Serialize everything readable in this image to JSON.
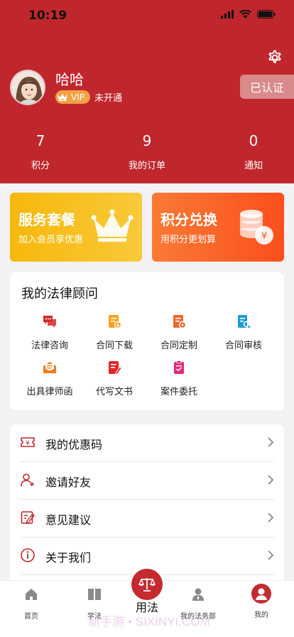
{
  "status_bar": {
    "time": "10:19"
  },
  "profile": {
    "name": "哈哈",
    "vip_badge": "VIP",
    "vip_status": "未开通",
    "verified_label": "已认证"
  },
  "stats": [
    {
      "value": "7",
      "label": "积分"
    },
    {
      "value": "9",
      "label": "我的订单"
    },
    {
      "value": "0",
      "label": "通知"
    }
  ],
  "promos": [
    {
      "title": "服务套餐",
      "subtitle": "加入会员享优惠"
    },
    {
      "title": "积分兑换",
      "subtitle": "用积分更划算"
    }
  ],
  "advisor": {
    "title": "我的法律顾问",
    "services": [
      {
        "label": "法律咨询",
        "icon": "chat-icon"
      },
      {
        "label": "合同下载",
        "icon": "contract-download-icon"
      },
      {
        "label": "合同定制",
        "icon": "contract-custom-icon"
      },
      {
        "label": "合同审核",
        "icon": "contract-review-icon"
      },
      {
        "label": "出具律师函",
        "icon": "lawyer-letter-icon"
      },
      {
        "label": "代写文书",
        "icon": "document-writing-icon"
      },
      {
        "label": "案件委托",
        "icon": "case-entrust-icon"
      }
    ]
  },
  "menu": [
    {
      "label": "我的优惠码",
      "icon": "coupon-icon"
    },
    {
      "label": "邀请好友",
      "icon": "invite-friend-icon"
    },
    {
      "label": "意见建议",
      "icon": "feedback-icon"
    },
    {
      "label": "关于我们",
      "icon": "info-icon"
    }
  ],
  "tabbar": {
    "items": [
      {
        "label": "首页",
        "icon": "home-icon"
      },
      {
        "label": "学法",
        "icon": "book-icon"
      },
      {
        "label": "我的法务部",
        "icon": "legal-dept-icon"
      },
      {
        "label": "我的",
        "icon": "profile-icon"
      }
    ],
    "center_label": "用法",
    "center_icon": "scales-icon"
  },
  "watermark": "新手游 • SIXINYI.COM",
  "colors": {
    "brand_red": "#c0272d",
    "promo_yellow": "#f6b80a",
    "promo_orange": "#fb5a22"
  }
}
